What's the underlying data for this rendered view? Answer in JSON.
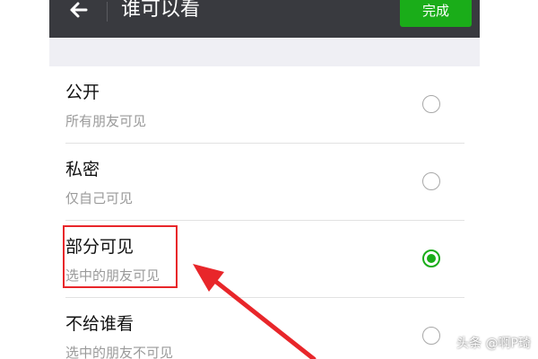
{
  "titlebar": {
    "title": "谁可以看",
    "done_label": "完成"
  },
  "options": [
    {
      "label": "公开",
      "desc": "所有朋友可见",
      "selected": false
    },
    {
      "label": "私密",
      "desc": "仅自己可见",
      "selected": false
    },
    {
      "label": "部分可见",
      "desc": "选中的朋友可见",
      "selected": true
    },
    {
      "label": "不给谁看",
      "desc": "选中的朋友不可见",
      "selected": false
    }
  ],
  "icons": {
    "back": "back-arrow-icon",
    "radio": "radio-icon"
  },
  "colors": {
    "titlebar": "#393a3f",
    "accent": "#1aad19",
    "annotation": "#e8262a",
    "background": "#efeff4"
  },
  "watermark": "头条 @啊P琦"
}
